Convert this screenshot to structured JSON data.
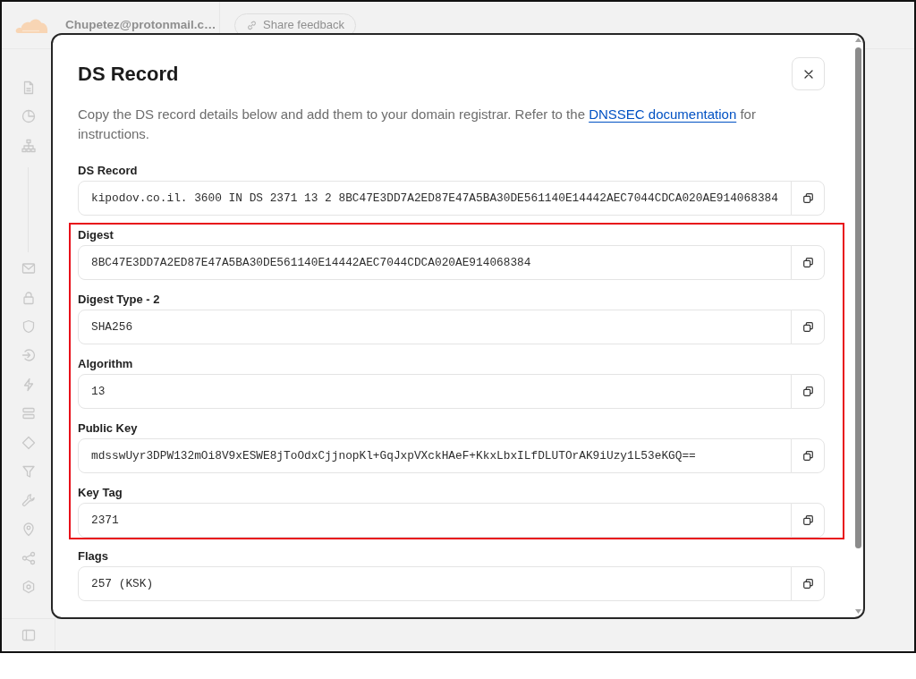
{
  "top_bar": {
    "account": "Chupetez@protonmail.c…",
    "feedback_button": "Share feedback"
  },
  "dialog": {
    "title": "DS Record",
    "description": {
      "text": "Copy the DS record details below and add them to your domain registrar. Refer to the",
      "link": "DNSSEC documentation",
      "text_after": "for instructions."
    },
    "fields": [
      {
        "label": "DS Record",
        "value": "kipodov.co.il. 3600 IN DS 2371 13 2 8BC47E3DD7A2ED87E47A5BA30DE561140E14442AEC7044CDCA020AE914068384",
        "highlighted": false
      },
      {
        "label": "Digest",
        "value": "8BC47E3DD7A2ED87E47A5BA30DE561140E14442AEC7044CDCA020AE914068384",
        "highlighted": true
      },
      {
        "label": "Digest Type - 2",
        "value": "SHA256",
        "highlighted": true
      },
      {
        "label": "Algorithm",
        "value": "13",
        "highlighted": true
      },
      {
        "label": "Public Key",
        "value": "mdsswUyr3DPW132mOi8V9xESWE8jToOdxCjjnopKl+GqJxpVXckHAeF+KkxLbxILfDLUTOrAK9iUzy1L53eKGQ==",
        "highlighted": true
      },
      {
        "label": "Key Tag",
        "value": "2371",
        "highlighted": true
      },
      {
        "label": "Flags",
        "value": "257 (KSK)",
        "highlighted": false
      }
    ]
  }
}
